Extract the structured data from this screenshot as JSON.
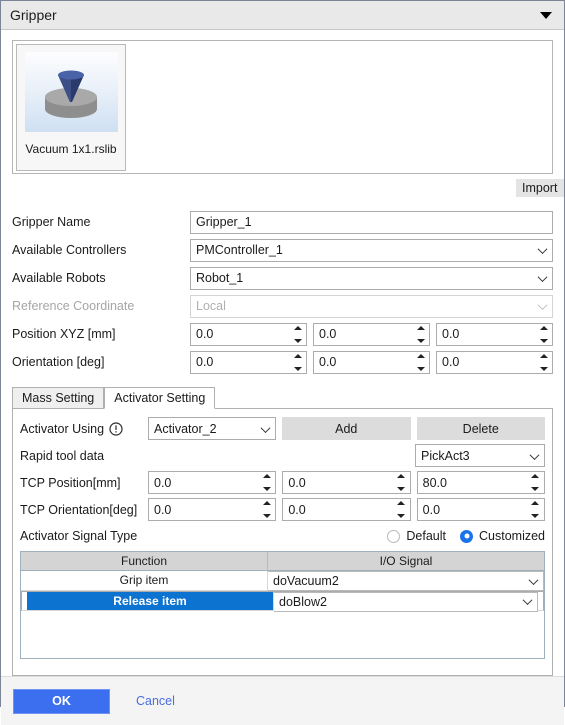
{
  "window": {
    "title": "Gripper",
    "collapse_icon": "caret-down-icon"
  },
  "gallery": {
    "item": {
      "name": "Vacuum 1x1.rslib",
      "thumbnail_icon": "vacuum-gripper-thumbnail"
    },
    "import_label": "Import"
  },
  "form": {
    "gripper_name": {
      "label": "Gripper Name",
      "value": "Gripper_1"
    },
    "available_controllers": {
      "label": "Available Controllers",
      "value": "PMController_1"
    },
    "available_robots": {
      "label": "Available Robots",
      "value": "Robot_1"
    },
    "reference_coordinate": {
      "label": "Reference Coordinate",
      "value": "Local",
      "disabled": true
    },
    "position_xyz": {
      "label": "Position XYZ [mm]",
      "values": [
        "0.0",
        "0.0",
        "0.0"
      ]
    },
    "orientation": {
      "label": "Orientation [deg]",
      "values": [
        "0.0",
        "0.0",
        "0.0"
      ]
    }
  },
  "tabs": [
    {
      "label": "Mass Setting",
      "active": false
    },
    {
      "label": "Activator Setting",
      "active": true
    }
  ],
  "activator": {
    "using_label": "Activator Using",
    "warning_icon": "exclamation-circle-icon",
    "using_value": "Activator_2",
    "add_label": "Add",
    "delete_label": "Delete",
    "rapid_tool_label": "Rapid tool data",
    "rapid_tool_value": "PickAct3",
    "tcp_position_label": "TCP Position[mm]",
    "tcp_position_values": [
      "0.0",
      "0.0",
      "80.0"
    ],
    "tcp_orientation_label": "TCP Orientation[deg]",
    "tcp_orientation_values": [
      "0.0",
      "0.0",
      "0.0"
    ],
    "signal_type_label": "Activator Signal Type",
    "radio_default_label": "Default",
    "radio_customized_label": "Customized",
    "selected_signal_type": "Customized"
  },
  "signal_table": {
    "headers": [
      "Function",
      "I/O Signal"
    ],
    "rows": [
      {
        "function": "Grip item",
        "io_signal": "doVacuum2",
        "selected": false
      },
      {
        "function": "Release item",
        "io_signal": "doBlow2",
        "selected": true
      }
    ]
  },
  "footer": {
    "ok_label": "OK",
    "cancel_label": "Cancel"
  },
  "colors": {
    "accent": "#1a73e8",
    "selection": "#0c73d1",
    "ok_button": "#3b6ff0",
    "link": "#4a6ee0"
  }
}
